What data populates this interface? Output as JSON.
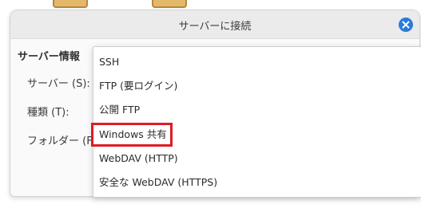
{
  "dialog": {
    "title": "サーバーに接続",
    "section_heading": "サーバー情報",
    "labels": {
      "server": "サーバー (S):",
      "type": "種類 (T):",
      "folder": "フォルダー (F)"
    }
  },
  "dropdown": {
    "options": [
      "SSH",
      "FTP (要ログイン)",
      "公開 FTP",
      "Windows 共有",
      "WebDAV (HTTP)",
      "安全な WebDAV (HTTPS)"
    ],
    "highlighted": "Windows 共有"
  },
  "colors": {
    "accent": "#2a7bd8",
    "highlight_border": "#e01b24",
    "folder_icon": "#e4b86a"
  },
  "icons": {
    "close": "close-icon",
    "folder": "folder-icon"
  }
}
